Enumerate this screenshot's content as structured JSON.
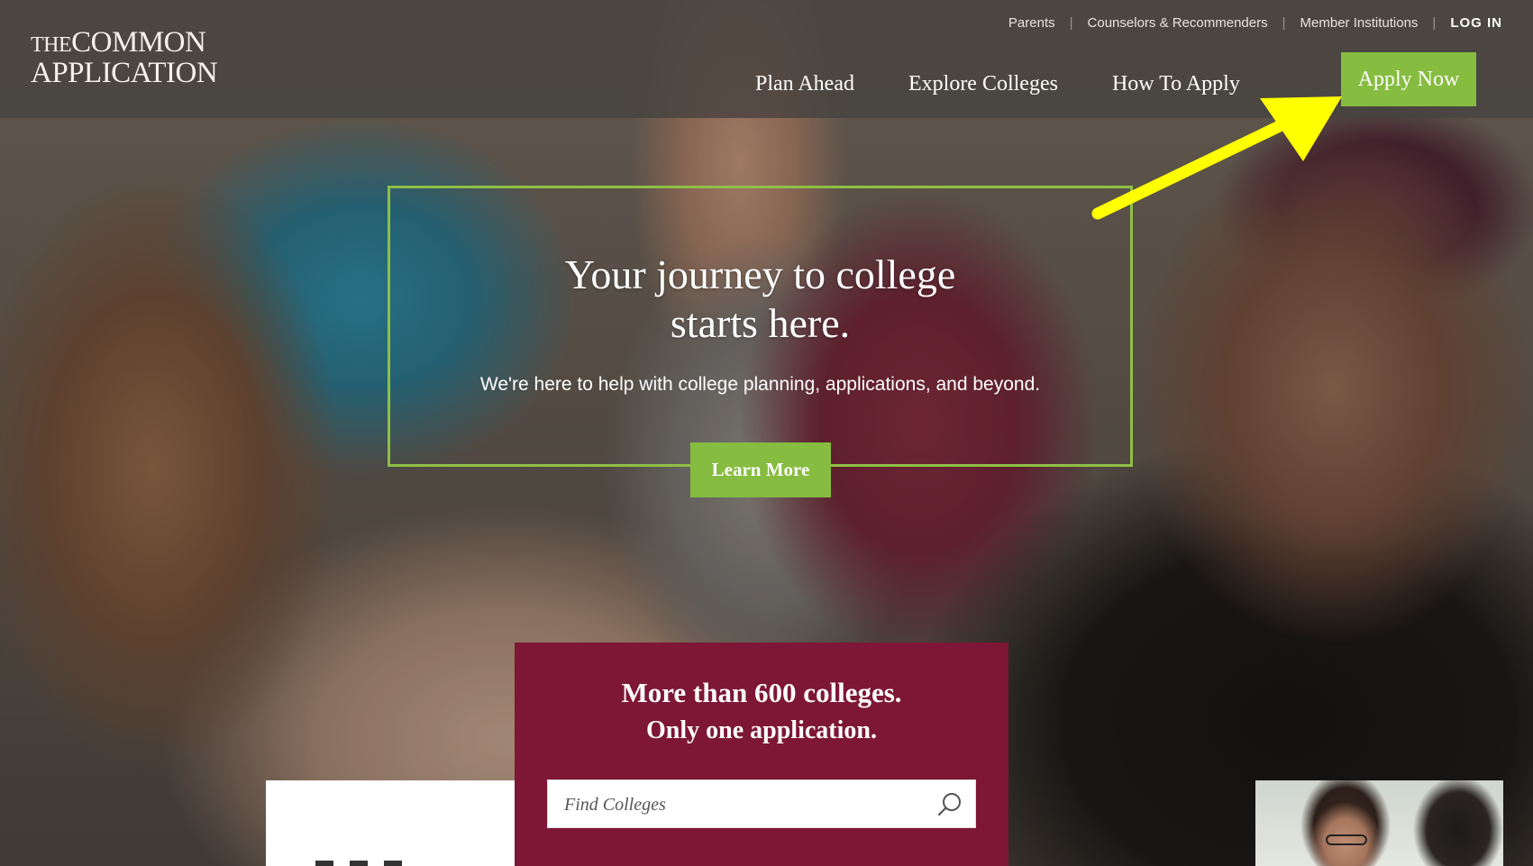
{
  "logo": {
    "line1_prefix": "THE",
    "line1_main": "COMMON",
    "line2": "APPLICATION"
  },
  "utility_nav": {
    "parents": "Parents",
    "counselors": "Counselors & Recommenders",
    "members": "Member Institutions",
    "login": "LOG IN"
  },
  "main_nav": {
    "plan_ahead": "Plan Ahead",
    "explore": "Explore Colleges",
    "how_to_apply": "How To Apply",
    "apply_now": "Apply Now"
  },
  "hero": {
    "headline_line1": "Your journey to college",
    "headline_line2": "starts here.",
    "subline": "We're here to help with college planning, applications, and beyond.",
    "cta": "Learn More"
  },
  "panel": {
    "title_line1": "More than 600 colleges.",
    "title_line2": "Only one application.",
    "search_placeholder": "Find Colleges"
  },
  "colors": {
    "accent_green": "#86bc3f",
    "maroon": "#7d1735",
    "annotation_arrow": "#ffff00"
  },
  "annotation": {
    "icon": "yellow-arrow-icon"
  }
}
